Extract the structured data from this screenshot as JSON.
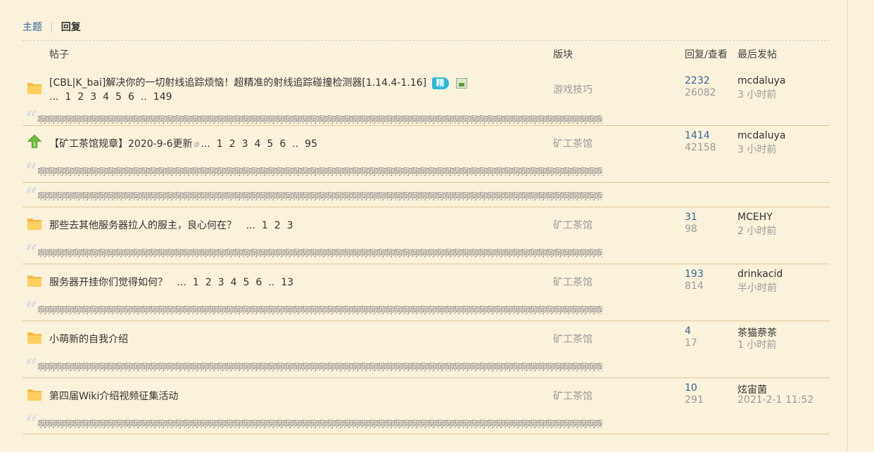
{
  "tabs": [
    {
      "label": "主题",
      "active": false
    },
    {
      "label": "回复",
      "active": true
    }
  ],
  "headers": {
    "post": "帖子",
    "forum": "版块",
    "stats": "回复/查看",
    "last": "最后发帖"
  },
  "quote_text": "啊啊啊啊啊啊啊啊啊啊啊啊啊啊啊啊啊啊啊啊啊啊啊啊啊啊啊啊啊啊啊啊啊啊啊啊啊啊啊啊啊啊啊啊啊啊啊啊啊啊啊啊啊啊啊啊啊啊啊啊啊啊啊啊啊啊啊啊啊啊",
  "quote_ellipsis": "...",
  "threads": [
    {
      "title": "[CBL|K_bai]解决你的一切射线追踪烦恼！超精准的射线追踪碰撞检测器[1.14.4-1.16]",
      "badge": "精",
      "pages": [
        "...",
        "1",
        "2",
        "3",
        "4",
        "5",
        "6",
        "..",
        "149"
      ],
      "forum": "游戏技巧",
      "replies": "2232",
      "views": "26082",
      "last_user": "mcdaluya",
      "last_time": "3 小时前"
    },
    {
      "title": "【矿工茶馆规章】2020-9-6更新",
      "pages": [
        "...",
        "1",
        "2",
        "3",
        "4",
        "5",
        "6",
        "..",
        "95"
      ],
      "forum": "矿工茶馆",
      "replies": "1414",
      "views": "42158",
      "last_user": "mcdaluya",
      "last_time": "3 小时前",
      "pin_num": "1"
    },
    {
      "title": "那些去其他服务器拉人的服主，良心何在？",
      "pages": [
        "...",
        "1",
        "2",
        "3"
      ],
      "forum": "矿工茶馆",
      "replies": "31",
      "views": "98",
      "last_user": "MCEHY",
      "last_time": "2 小时前"
    },
    {
      "title": "服务器开挂你们觉得如何？",
      "pages": [
        "...",
        "1",
        "2",
        "3",
        "4",
        "5",
        "6",
        "..",
        "13"
      ],
      "forum": "矿工茶馆",
      "replies": "193",
      "views": "814",
      "last_user": "drinkacid",
      "last_time": "半小时前"
    },
    {
      "title": "小萌新的自我介绍",
      "forum": "矿工茶馆",
      "replies": "4",
      "views": "17",
      "last_user": "茶猫萘茶",
      "last_time": "1 小时前"
    },
    {
      "title": "第四届Wiki介绍视频征集活动",
      "forum": "矿工茶馆",
      "replies": "10",
      "views": "291",
      "last_user": "炫宙菌",
      "last_time": "2021-2-1 11:52"
    }
  ],
  "colors": {
    "background": "#fbf2db",
    "link": "#336699",
    "muted": "#999999",
    "divider": "#e0c894"
  }
}
